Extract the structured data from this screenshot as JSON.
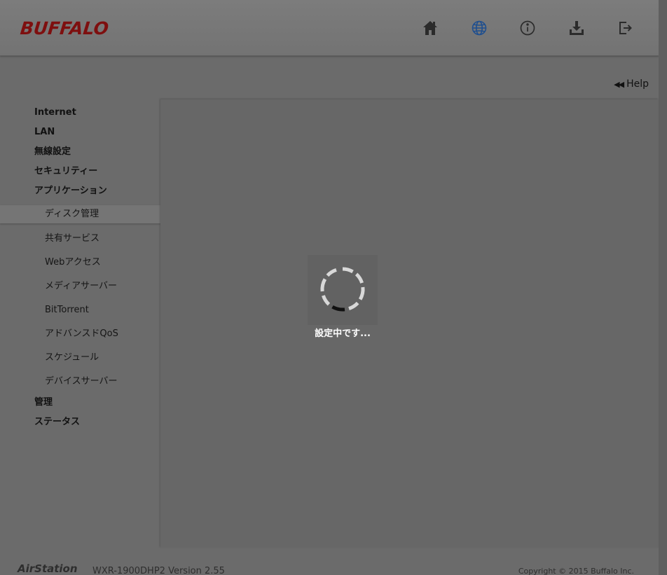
{
  "header": {
    "logo": "BUFFALO",
    "icons": [
      "home-icon",
      "globe-icon",
      "info-icon",
      "download-icon",
      "logout-icon"
    ],
    "accent_color": "#1f4f8f",
    "logo_color": "#7e0f0f"
  },
  "help": {
    "label": "Help"
  },
  "sidebar": {
    "items": [
      {
        "label": "Internet"
      },
      {
        "label": "LAN"
      },
      {
        "label": "無線設定"
      },
      {
        "label": "セキュリティー"
      },
      {
        "label": "アプリケーション"
      },
      {
        "label": "ディスク管理"
      },
      {
        "label": "共有サービス"
      },
      {
        "label": "Webアクセス"
      },
      {
        "label": "メディアサーバー"
      },
      {
        "label": "BitTorrent"
      },
      {
        "label": "アドバンスドQoS"
      },
      {
        "label": "スケジュール"
      },
      {
        "label": "デバイスサーバー"
      },
      {
        "label": "管理"
      },
      {
        "label": "ステータス"
      }
    ],
    "active_label": "ディスク管理"
  },
  "loading": {
    "text": "設定中です..."
  },
  "footer": {
    "brand": "AirStation",
    "model": "WXR-1900DHP2  Version 2.55",
    "copyright": "Copyright © 2015 Buffalo Inc."
  }
}
